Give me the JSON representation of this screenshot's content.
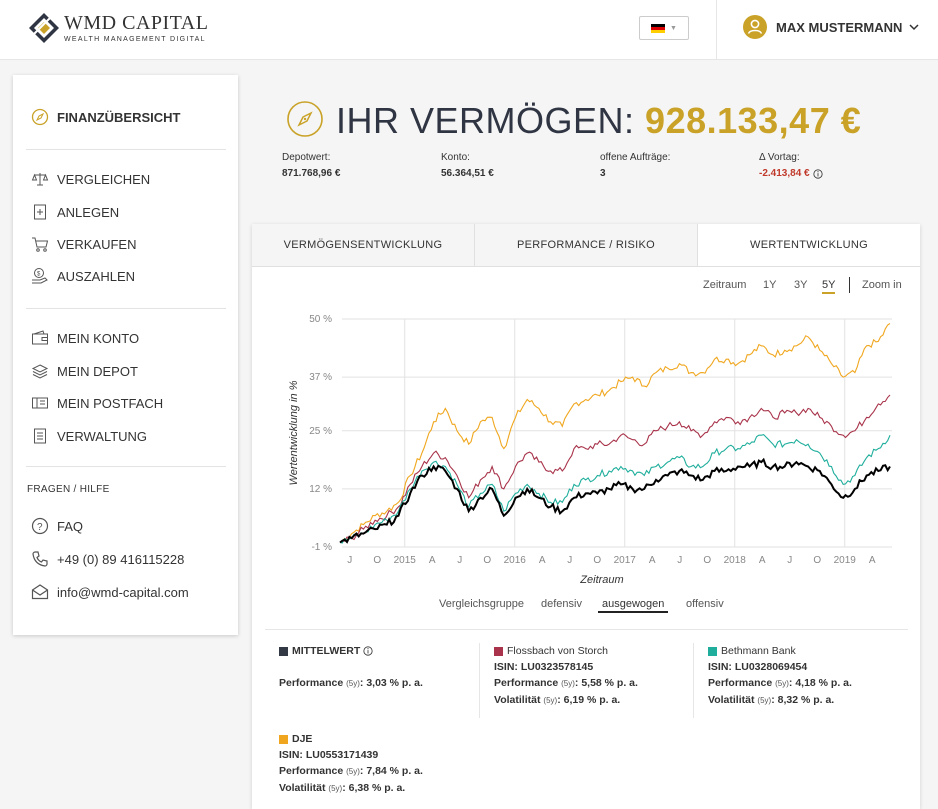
{
  "brand": {
    "name": "WMD CAPITAL",
    "tagline": "WEALTH MANAGEMENT DIGITAL"
  },
  "header": {
    "language_icon": "german-flag-icon",
    "user_name": "MAX MUSTERMANN"
  },
  "sidebar": {
    "primary": [
      {
        "label": "FINANZÜBERSICHT",
        "icon": "compass-icon"
      }
    ],
    "actions": [
      {
        "label": "VERGLEICHEN",
        "icon": "scale-icon"
      },
      {
        "label": "ANLEGEN",
        "icon": "document-plus-icon"
      },
      {
        "label": "VERKAUFEN",
        "icon": "cart-icon"
      },
      {
        "label": "AUSZAHLEN",
        "icon": "coin-hand-icon"
      }
    ],
    "account": [
      {
        "label": "MEIN KONTO",
        "icon": "wallet-icon"
      },
      {
        "label": "MEIN DEPOT",
        "icon": "layers-icon"
      },
      {
        "label": "MEIN POSTFACH",
        "icon": "mailbox-icon"
      },
      {
        "label": "VERWALTUNG",
        "icon": "document-icon"
      }
    ],
    "help_title": "FRAGEN / HILFE",
    "help": [
      {
        "label": "FAQ",
        "icon": "question-icon"
      },
      {
        "label": "+49 (0) 89 416115228",
        "icon": "phone-icon"
      },
      {
        "label": "info@wmd-capital.com",
        "icon": "mail-icon"
      }
    ]
  },
  "hero": {
    "title": "IHR VERMÖGEN:",
    "amount": "928.133,47 €"
  },
  "kpis": [
    {
      "label": "Depotwert:",
      "value": "871.768,96 €"
    },
    {
      "label": "Konto:",
      "value": "56.364,51 €"
    },
    {
      "label": "offene Aufträge:",
      "value": "3"
    },
    {
      "label": "Δ Vortag:",
      "value": "-2.413,84 €"
    }
  ],
  "tabs": [
    "VERMÖGENSENTWICKLUNG",
    "PERFORMANCE / RISIKO",
    "WERTENTWICKLUNG"
  ],
  "range": {
    "label": "Zeitraum",
    "options": [
      "1Y",
      "3Y",
      "5Y"
    ],
    "selected": "5Y",
    "zoom": "Zoom in"
  },
  "comparison": {
    "label": "Vergleichsgruppe",
    "options": [
      "defensiv",
      "ausgewogen",
      "offensiv"
    ],
    "selected": "ausgewogen"
  },
  "colors": {
    "gold": "#c9a227",
    "mittelwert": "#000000",
    "flossbach": "#a8334a",
    "bethmann": "#1fae9c",
    "dje": "#f0a71f"
  },
  "chart_data": {
    "type": "line",
    "xlabel": "Zeitraum",
    "ylabel": "Wertentwicklung in %",
    "ylim": [
      -1,
      50
    ],
    "y_ticks": [
      "50 %",
      "37 %",
      "25 %",
      "12 %",
      "-1 %"
    ],
    "x_ticks": [
      "J",
      "O",
      "2015",
      "A",
      "J",
      "O",
      "2016",
      "A",
      "J",
      "O",
      "2017",
      "A",
      "J",
      "O",
      "2018",
      "A",
      "J",
      "O",
      "2019",
      "A"
    ],
    "series": [
      {
        "name": "DJE",
        "color": "#f0a71f",
        "values": [
          0,
          2,
          4,
          6,
          7,
          9,
          15,
          20,
          27,
          30,
          25,
          22,
          27,
          28,
          21,
          28,
          32,
          30,
          27,
          26,
          31,
          32,
          33,
          34,
          36,
          37,
          35,
          38,
          39,
          40,
          38,
          38,
          41,
          41,
          40,
          42,
          44,
          42,
          43,
          44,
          46,
          43,
          40,
          37,
          38,
          44,
          45,
          49
        ]
      },
      {
        "name": "Flossbach von Storch",
        "color": "#a8334a",
        "values": [
          0,
          1,
          3,
          5,
          6,
          8,
          13,
          17,
          20,
          19,
          15,
          10,
          14,
          17,
          12,
          17,
          20,
          18,
          16,
          16,
          21,
          21,
          22,
          22,
          24,
          23,
          22,
          25,
          26,
          27,
          25,
          24,
          27,
          28,
          27,
          28,
          30,
          28,
          29,
          29,
          30,
          28,
          26,
          24,
          25,
          28,
          31,
          33
        ]
      },
      {
        "name": "Bethmann Bank",
        "color": "#1fae9c",
        "values": [
          0,
          1,
          2,
          4,
          5,
          7,
          12,
          16,
          18,
          17,
          13,
          8,
          11,
          13,
          7,
          11,
          13,
          11,
          9,
          9,
          13,
          14,
          15,
          16,
          17,
          16,
          15,
          17,
          18,
          19,
          17,
          17,
          20,
          21,
          21,
          22,
          24,
          22,
          22,
          23,
          22,
          20,
          17,
          13,
          15,
          19,
          21,
          24
        ]
      },
      {
        "name": "MITTELWERT",
        "color": "#000000",
        "values": [
          0,
          1,
          2,
          3,
          4,
          6,
          11,
          15,
          17,
          16,
          12,
          7,
          10,
          12,
          6,
          10,
          12,
          10,
          8,
          7,
          10,
          11,
          11,
          12,
          13,
          12,
          12,
          14,
          15,
          16,
          15,
          14,
          16,
          16,
          17,
          17,
          18,
          17,
          17,
          18,
          17,
          16,
          13,
          10,
          12,
          15,
          16,
          17
        ]
      }
    ]
  },
  "funds": [
    {
      "name": "MITTELWERT",
      "color": "#333a45",
      "info_icon": "info-icon",
      "isin": "",
      "performance": "Performance",
      "period": "(5y)",
      "performance_value": ": 3,03 % p. a.",
      "volatility": "",
      "volatility_value": ""
    },
    {
      "name": "Flossbach von Storch",
      "color": "#a8334a",
      "isin": "ISIN: LU0323578145",
      "performance": "Performance",
      "period": "(5y)",
      "performance_value": ": 5,58 % p. a.",
      "volatility": "Volatilität",
      "volatility_value": ": 6,19 % p. a."
    },
    {
      "name": "Bethmann Bank",
      "color": "#1fae9c",
      "isin": "ISIN: LU0328069454",
      "performance": "Performance",
      "period": "(5y)",
      "performance_value": ": 4,18 % p. a.",
      "volatility": "Volatilität",
      "volatility_value": ": 8,32 % p. a."
    },
    {
      "name": "DJE",
      "color": "#f0a71f",
      "isin": "ISIN: LU0553171439",
      "performance": "Performance",
      "period": "(5y)",
      "performance_value": ": 7,84 % p. a.",
      "volatility": "Volatilität",
      "volatility_value": ": 6,38 % p. a."
    }
  ]
}
